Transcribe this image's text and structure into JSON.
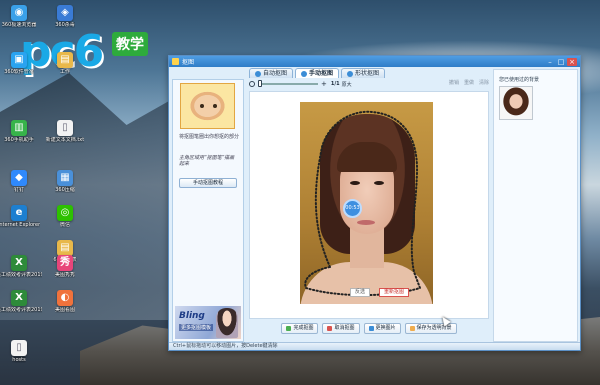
{
  "logo": {
    "brand": "pc6",
    "badge": "教学"
  },
  "desktop_icons": [
    {
      "label": "360极速浏览器",
      "color": "#3aa0e8",
      "glyph": "◉"
    },
    {
      "label": "360杀毒",
      "color": "#3a7bd5",
      "glyph": "◈"
    },
    {
      "label": "360软件管家",
      "color": "#2aa3f0",
      "glyph": "▣"
    },
    {
      "label": "工作",
      "color": "#e9b84a",
      "glyph": "▤"
    },
    {
      "label": "360手机助手",
      "color": "#37b34a",
      "glyph": "▥"
    },
    {
      "label": "新建文本文档.txt",
      "color": "#f2f2f2",
      "glyph": "▯"
    },
    {
      "label": "钉钉",
      "color": "#2f89fc",
      "glyph": "◆"
    },
    {
      "label": "360压缩",
      "color": "#4a90d9",
      "glyph": "▦"
    },
    {
      "label": "Internet Explorer",
      "color": "#1d7fd0",
      "glyph": "e"
    },
    {
      "label": "微信",
      "color": "#2dc100",
      "glyph": "◎"
    },
    {
      "label": "6月考评表",
      "color": "#e8b84a",
      "glyph": "▤"
    },
    {
      "label": "员工绩效考评表201906...",
      "color": "#2e8b3a",
      "glyph": "X"
    },
    {
      "label": "美图秀秀",
      "color": "#e8457a",
      "glyph": "秀"
    },
    {
      "label": "员工绩效考评表201906...",
      "color": "#2e8b3a",
      "glyph": "X"
    },
    {
      "label": "美图看图",
      "color": "#f0723c",
      "glyph": "◐"
    },
    {
      "label": "hosts",
      "color": "#f2f2f2",
      "glyph": "▯"
    }
  ],
  "window": {
    "title": "抠图",
    "tabs": [
      "自动抠图",
      "手动抠图",
      "形状抠图"
    ],
    "active_tab": 1,
    "left_panel": {
      "hint": "将抠图笔圈出你想抠的部分",
      "hint2": "主角区域用“抠图笔”描画起来",
      "manual_button": "手动抠图教程",
      "ad_title": "Bling",
      "ad_subtitle": "更多抠图模板"
    },
    "toolbar": {
      "zoom_level": "1/1",
      "original_label": "原大",
      "tools": [
        "撤销",
        "重做",
        "清除"
      ]
    },
    "canvas": {
      "timer": "00:53",
      "undo_button": "反选",
      "redraw_button": "重新抠图"
    },
    "right_panel": {
      "title": "您已使用过的背景"
    },
    "actions": [
      {
        "label": "完成抠图",
        "color": "#4caf50"
      },
      {
        "label": "取消抠图",
        "color": "#d9534f"
      },
      {
        "label": "更换图片",
        "color": "#3b8dd6"
      },
      {
        "label": "保存为透明背景",
        "color": "#f0ad4e"
      }
    ],
    "status": "Ctrl+鼠标拖动可以移动图片，按Delete键清除"
  }
}
